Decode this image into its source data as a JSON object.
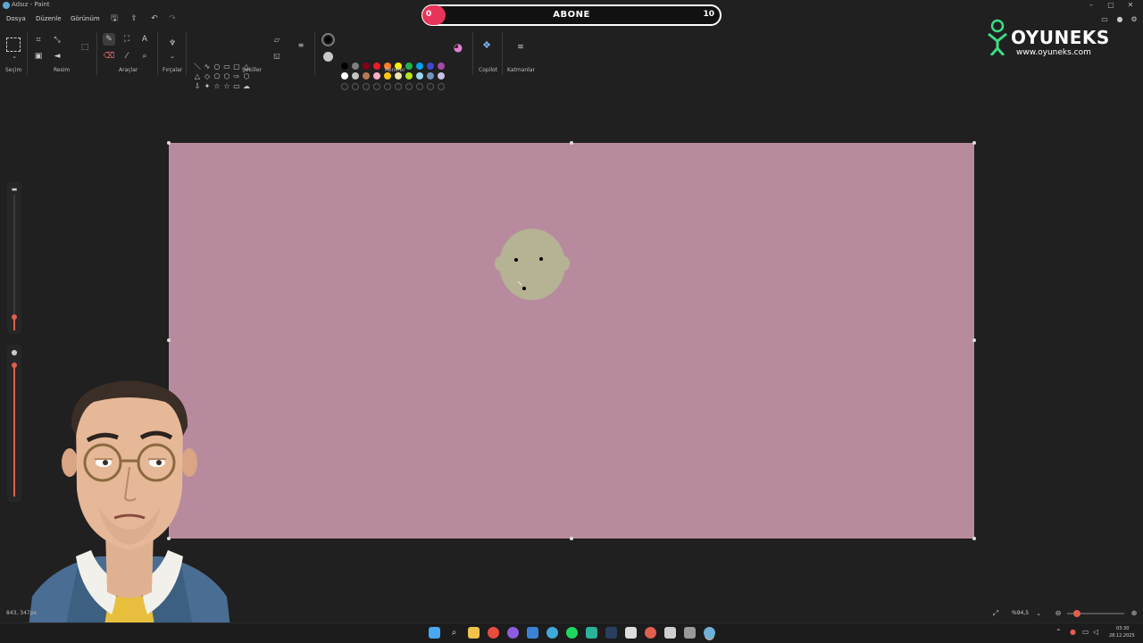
{
  "window": {
    "title": "Adsız - Paint",
    "controls": [
      "–",
      "▢",
      "✕"
    ]
  },
  "menu": {
    "file": "Dosya",
    "edit": "Düzenle",
    "view": "Görünüm"
  },
  "subscribe": {
    "current": "0",
    "label": "ABONE",
    "goal": "10"
  },
  "logo": {
    "name": "OYUNEKS",
    "url": "www.oyuneks.com"
  },
  "ribbon": {
    "groups": {
      "selection": "Seçim",
      "image": "Resim",
      "tools": "Araçlar",
      "brushes": "Fırçalar",
      "shapes": "Şekiller",
      "colors": "Renkler",
      "copilot": "Copilot",
      "layers": "Katmanlar"
    },
    "shape_glyphs": [
      "＼",
      "∿",
      "○",
      "▭",
      "▢",
      "△",
      "△",
      "◇",
      "⬠",
      "⬡",
      "⇨",
      "⬡",
      "⇩",
      "✦",
      "☆",
      "☆",
      "▭",
      "☁"
    ],
    "palette": {
      "row1": [
        "#000000",
        "#7f7f7f",
        "#880015",
        "#ed1c24",
        "#ff7f27",
        "#fff200",
        "#22b14c",
        "#00a2e8",
        "#3f48cc",
        "#a349a4"
      ],
      "row2": [
        "#ffffff",
        "#c3c3c3",
        "#b97a57",
        "#ffaec9",
        "#ffc90e",
        "#efe4b0",
        "#b5e61d",
        "#99d9ea",
        "#7092be",
        "#c8bfe7"
      ],
      "primary": "#000000",
      "secondary": "#c8c8c8"
    }
  },
  "canvas": {
    "background": "#b78b9d",
    "face_color": "#b5b394"
  },
  "status": {
    "coords": "843, 347px",
    "zoom": "%94,5"
  },
  "taskbar": {
    "time": "03:30",
    "date": "28.12.2025",
    "apps": [
      "start",
      "search",
      "files",
      "chrome",
      "firefox",
      "vscode",
      "telegram",
      "spotify",
      "app",
      "steam",
      "notion",
      "app",
      "app",
      "app",
      "paint"
    ]
  }
}
